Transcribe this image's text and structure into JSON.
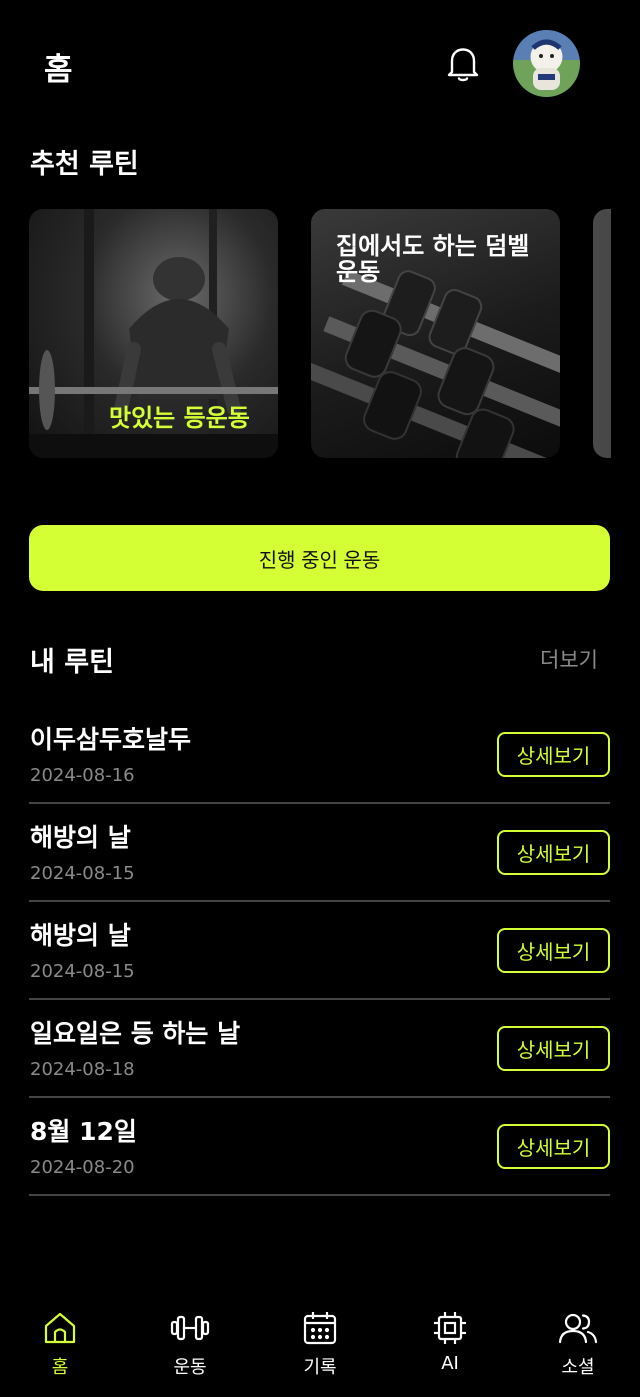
{
  "header": {
    "title": "홈",
    "bell_icon": "bell-icon",
    "avatar_icon": "user-avatar"
  },
  "recommended": {
    "title": "추천 루틴",
    "cards": [
      {
        "label": "맛있는 등운동"
      },
      {
        "label": "집에서도 하는 덤벨 운동"
      }
    ]
  },
  "in_progress": {
    "label": "진행 중인 운동"
  },
  "my_routines": {
    "title": "내 루틴",
    "more_label": "더보기",
    "detail_label": "상세보기",
    "items": [
      {
        "name": "이두삼두호날두",
        "date": "2024-08-16"
      },
      {
        "name": "해방의 날",
        "date": "2024-08-15"
      },
      {
        "name": "해방의 날",
        "date": "2024-08-15"
      },
      {
        "name": "일요일은 등 하는 날",
        "date": "2024-08-18"
      },
      {
        "name": "8월 12일",
        "date": "2024-08-20"
      }
    ]
  },
  "nav": {
    "items": [
      {
        "label": "홈",
        "icon": "home-icon",
        "active": true
      },
      {
        "label": "운동",
        "icon": "dumbbell-icon",
        "active": false
      },
      {
        "label": "기록",
        "icon": "calendar-icon",
        "active": false
      },
      {
        "label": "AI",
        "icon": "chip-icon",
        "active": false
      },
      {
        "label": "소셜",
        "icon": "users-icon",
        "active": false
      }
    ]
  },
  "colors": {
    "accent": "#d4ff34",
    "background": "#000000",
    "muted": "#8a8a8a",
    "divider": "#444444"
  }
}
